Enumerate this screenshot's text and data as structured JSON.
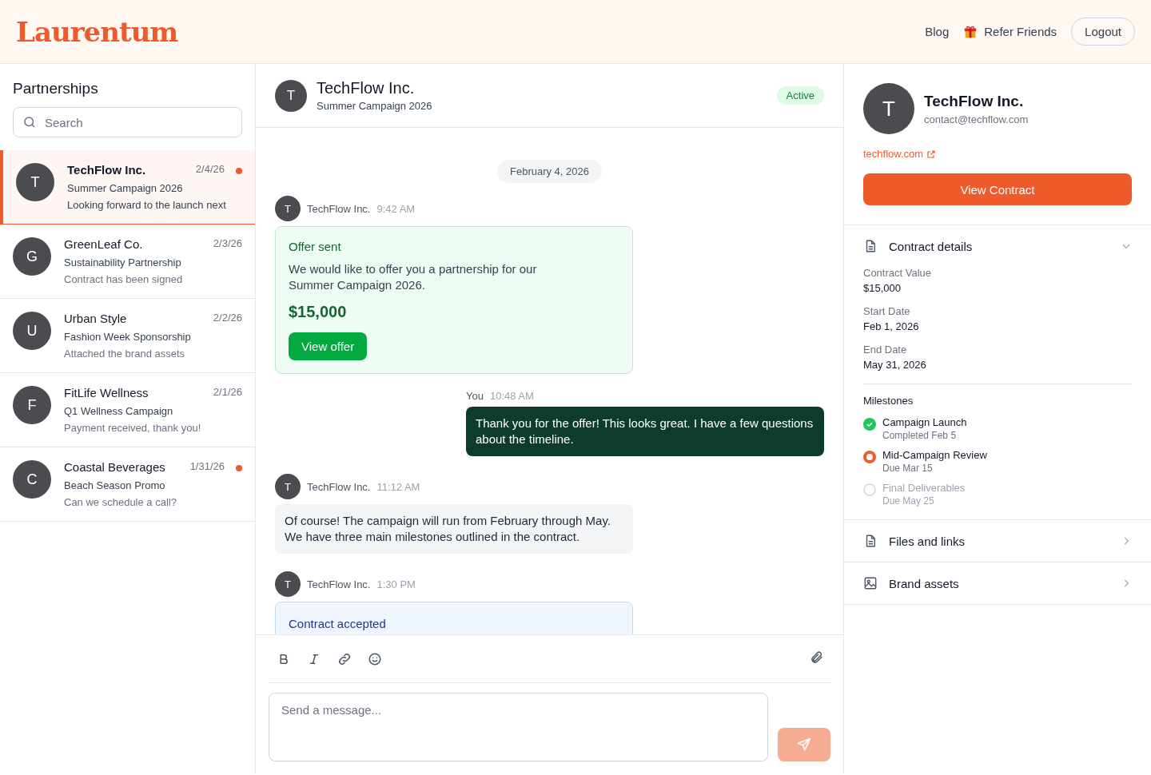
{
  "header": {
    "logo": "Laurentum",
    "links": [
      {
        "label": "Blog",
        "kind": "link"
      },
      {
        "label": "Refer Friends",
        "kind": "gift"
      }
    ],
    "logout": "Logout"
  },
  "sidebar": {
    "title": "Partnerships",
    "search": {
      "placeholder": "Search"
    },
    "conversations": [
      {
        "avatar": "T",
        "name": "TechFlow Inc.",
        "date": "2/4/26",
        "campaign": "Summer Campaign 2026",
        "preview": "Looking forward to the launch next",
        "selected": true,
        "unread": true
      },
      {
        "avatar": "G",
        "name": "GreenLeaf Co.",
        "date": "2/3/26",
        "campaign": "Sustainability Partnership",
        "preview": "Contract has been signed",
        "selected": false,
        "unread": false
      },
      {
        "avatar": "U",
        "name": "Urban Style",
        "date": "2/2/26",
        "campaign": "Fashion Week Sponsorship",
        "preview": "Attached the brand assets",
        "selected": false,
        "unread": false
      },
      {
        "avatar": "F",
        "name": "FitLife Wellness",
        "date": "2/1/26",
        "campaign": "Q1 Wellness Campaign",
        "preview": "Payment received, thank you!",
        "selected": false,
        "unread": false
      },
      {
        "avatar": "C",
        "name": "Coastal Beverages",
        "date": "1/31/26",
        "campaign": "Beach Season Promo",
        "preview": "Can we schedule a call?",
        "selected": false,
        "unread": true
      }
    ]
  },
  "chat": {
    "avatar": "T",
    "title": "TechFlow Inc.",
    "subtitle": "Summer Campaign 2026",
    "status": "Active",
    "date_divider": "February 4, 2026",
    "messages": [
      {
        "kind": "offer",
        "avatar": "T",
        "sender": "TechFlow Inc.",
        "time": "9:42 AM",
        "title": "Offer sent",
        "body": "We would like to offer you a partnership for our Summer Campaign 2026.",
        "amount": "$15,000",
        "button": "View offer"
      },
      {
        "kind": "outgoing",
        "sender": "You",
        "time": "10:48 AM",
        "body": "Thank you for the offer! This looks great. I have a few questions about the timeline."
      },
      {
        "kind": "incoming",
        "avatar": "T",
        "sender": "TechFlow Inc.",
        "time": "11:12 AM",
        "body": "Of course! The campaign will run from February through May. We have three main milestones outlined in the contract."
      },
      {
        "kind": "contract",
        "avatar": "T",
        "sender": "TechFlow Inc.",
        "time": "1:30 PM",
        "title": "Contract accepted"
      }
    ],
    "composer": {
      "placeholder": "Send a message..."
    }
  },
  "details": {
    "avatar": "T",
    "name": "TechFlow Inc.",
    "email": "contact@techflow.com",
    "website": "techflow.com",
    "button": "View Contract",
    "contract": {
      "title": "Contract details",
      "expanded": true,
      "fields": [
        {
          "label": "Contract Value",
          "value": "$15,000"
        },
        {
          "label": "Start Date",
          "value": "Feb 1, 2026"
        },
        {
          "label": "End Date",
          "value": "May 31, 2026"
        }
      ],
      "milestones_title": "Milestones",
      "milestones": [
        {
          "name": "Campaign Launch",
          "note": "Completed Feb 5",
          "done": true,
          "current": false
        },
        {
          "name": "Mid-Campaign Review",
          "note": "Due Mar 15",
          "done": false,
          "current": true
        },
        {
          "name": "Final Deliverables",
          "note": "Due May 25",
          "done": false,
          "current": false
        }
      ]
    },
    "sections": [
      {
        "kind": "files",
        "title": "Files and links"
      },
      {
        "kind": "images",
        "title": "Brand assets"
      }
    ]
  }
}
